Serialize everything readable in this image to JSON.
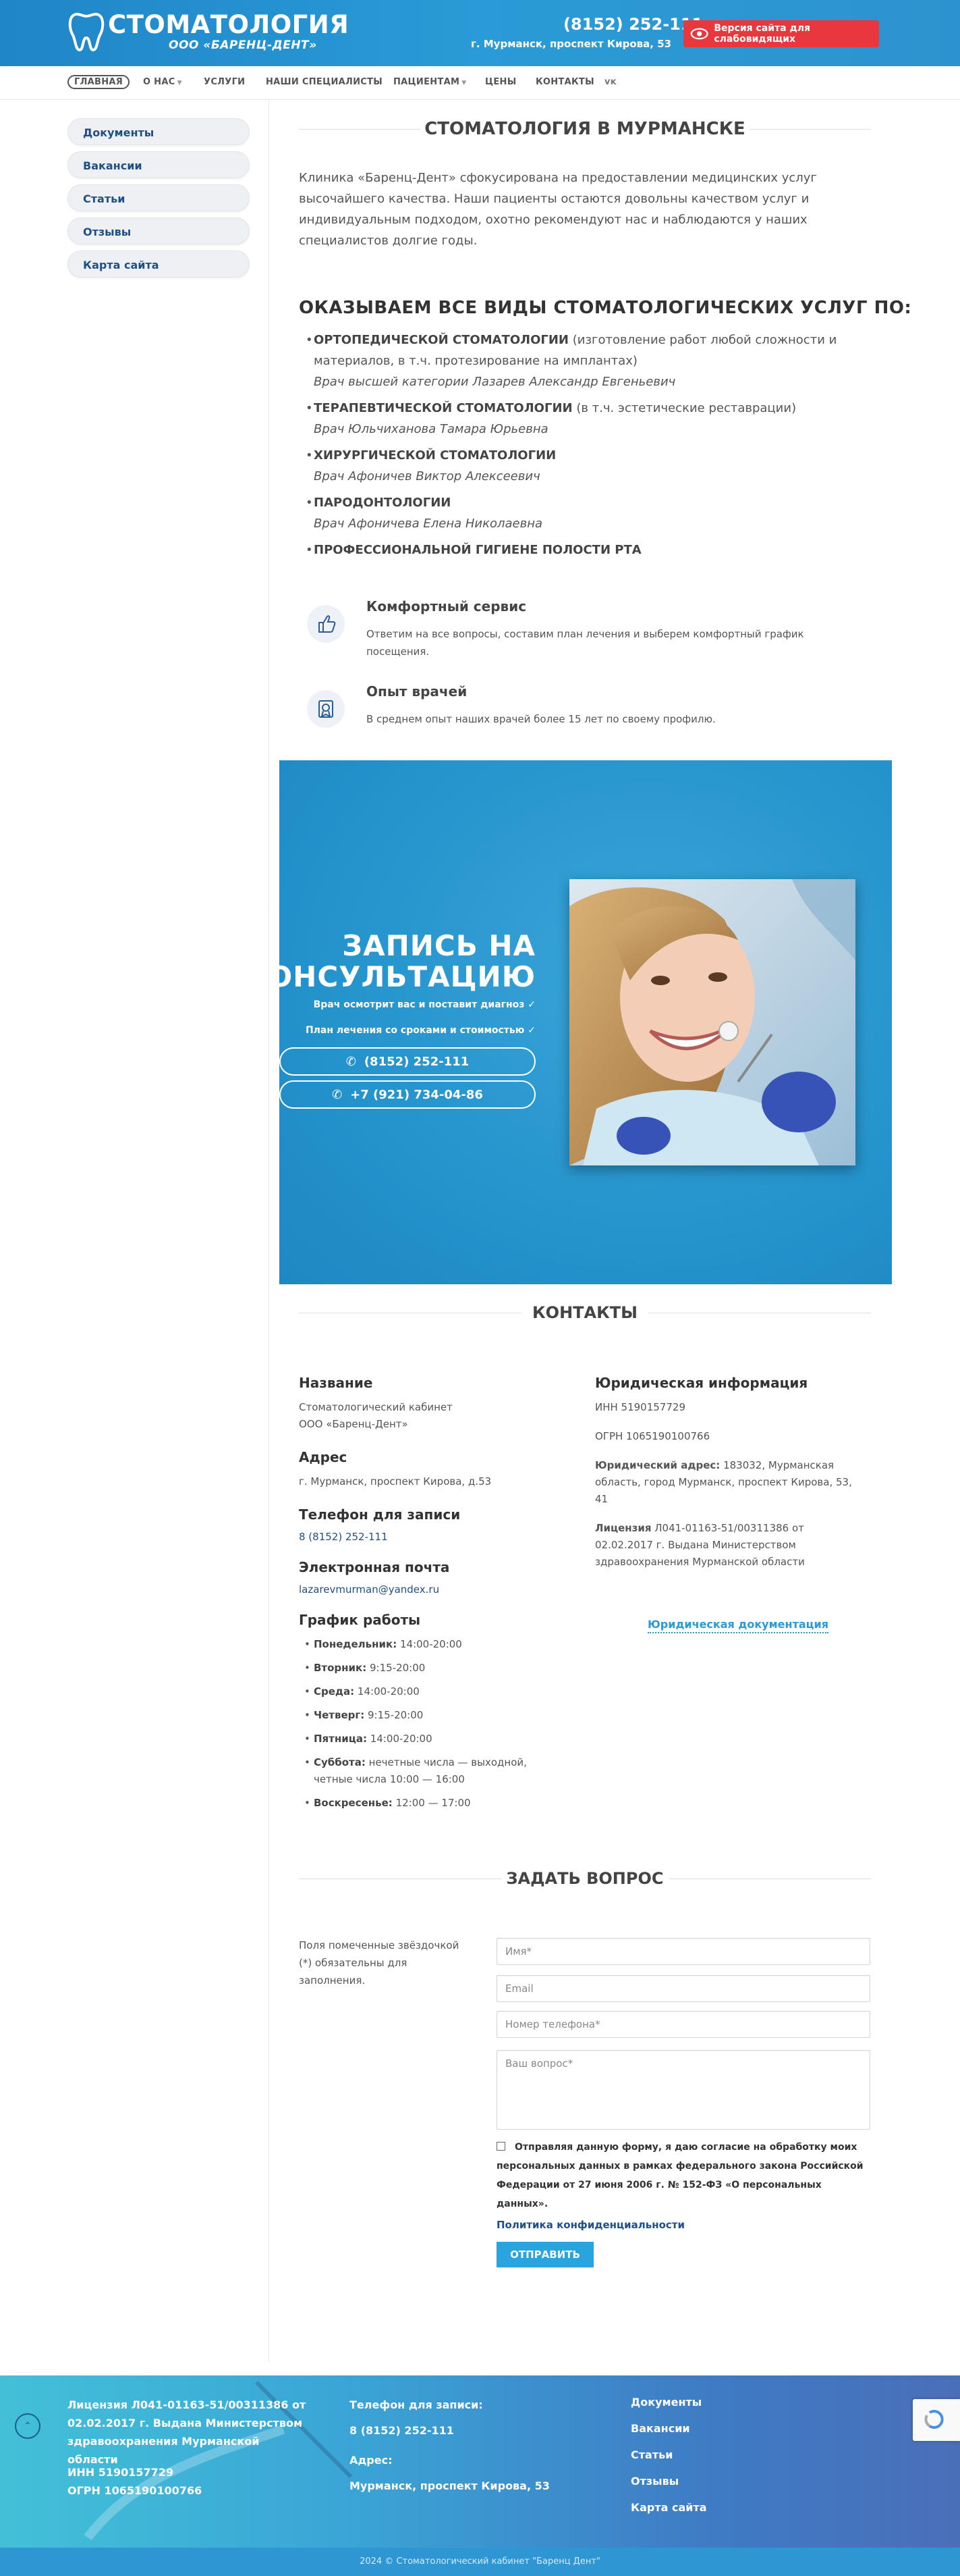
{
  "header": {
    "logo_title": "СТОМАТОЛОГИЯ",
    "logo_sub": "ООО «БАРЕНЦ-ДЕНТ»",
    "phone": "(8152) 252-111",
    "address": "г. Мурманск, проспект Кирова, 53",
    "vision_button": "Версия сайта для слабовидящих"
  },
  "nav": {
    "items": [
      "ГЛАВНАЯ",
      "О НАС",
      "УСЛУГИ",
      "НАШИ СПЕЦИАЛИСТЫ",
      "ПАЦИЕНТАМ",
      "ЦЕНЫ",
      "КОНТАКТЫ"
    ]
  },
  "sidebar": {
    "items": [
      "Документы",
      "Вакансии",
      "Статьи",
      "Отзывы",
      "Карта сайта"
    ]
  },
  "main": {
    "title": "СТОМАТОЛОГИЯ В МУРМАНСКЕ",
    "intro": "Клиника «Баренц-Дент» сфокусирована на предоставлении медицинских услуг высочайшего качества. Наши пациенты остаются довольны качеством услуг и индивидуальным подходом, охотно рекомендуют нас и наблюдаются у наших специалистов долгие годы.",
    "services_title": "ОКАЗЫВАЕМ ВСЕ ВИДЫ СТОМАТОЛОГИЧЕСКИХ УСЛУГ ПО:",
    "services": [
      {
        "name": "ОРТОПЕДИЧЕСКОЙ СТОМАТОЛОГИИ",
        "extra": " (изготовление работ любой сложности и материалов, в т.ч. протезирование на имплантах)",
        "doctor": "Врач высшей категории Лазарев Александр Евгеньевич"
      },
      {
        "name": "ТЕРАПЕВТИЧЕСКОЙ СТОМАТОЛОГИИ",
        "extra": " (в т.ч. эстетические реставрации)",
        "doctor": "Врач Юльчиханова Тамара Юрьевна"
      },
      {
        "name": "ХИРУРГИЧЕСКОЙ СТОМАТОЛОГИИ",
        "extra": "",
        "doctor": "Врач Афоничев Виктор Алексеевич"
      },
      {
        "name": "ПАРОДОНТОЛОГИИ",
        "extra": "",
        "doctor": "Врач Афоничева Елена Николаевна"
      },
      {
        "name": "ПРОФЕССИОНАЛЬНОЙ ГИГИЕНЕ ПОЛОСТИ РТА",
        "extra": "",
        "doctor": ""
      }
    ],
    "features": [
      {
        "title": "Комфортный сервис",
        "text": "Ответим на все вопросы, составим план лечения и выберем комфортный график посещения."
      },
      {
        "title": "Опыт врачей",
        "text": "В среднем опыт наших врачей более 15 лет по своему профилю."
      }
    ]
  },
  "banner": {
    "title_line1": "ЗАПИСЬ НА",
    "title_line2": "КОНСУЛЬТАЦИЮ",
    "note1": "Врач осмотрит вас и поставит диагноз ✓",
    "note2": "План лечения со сроками и стоимостью ✓",
    "phone1": "(8152) 252-111",
    "phone2": "+7 (921) 734-04-86"
  },
  "contacts": {
    "title": "КОНТАКТЫ",
    "name_h": "Название",
    "name_v": "Стоматологический кабинет ООО «Баренц-Дент»",
    "addr_h": "Адрес",
    "addr_v": "г. Мурманск, проспект Кирова, д.53",
    "phone_h": "Телефон для записи",
    "phone_v": "8 (8152) 252-111",
    "email_h": "Электронная почта",
    "email_v": "lazarevmurman@yandex.ru",
    "hours_h": "График работы",
    "hours": [
      {
        "day": "Понедельник:",
        "time": " 14:00-20:00"
      },
      {
        "day": "Вторник:",
        "time": " 9:15-20:00"
      },
      {
        "day": "Среда:",
        "time": " 14:00-20:00"
      },
      {
        "day": "Четверг:",
        "time": " 9:15-20:00"
      },
      {
        "day": "Пятница:",
        "time": " 14:00-20:00"
      },
      {
        "day": "Суббота:",
        "time": " нечетные числа — выходной, четные числа 10:00 — 16:00"
      },
      {
        "day": "Воскресенье:",
        "time": " 12:00 — 17:00"
      }
    ],
    "jur_h": "Юридическая информация",
    "inn": "ИНН 5190157729",
    "ogrn": "ОГРН 1065190100766",
    "jur_addr_label": "Юридический адрес:",
    "jur_addr": " 183032, Мурманская область, город Мурманск, проспект Кирова, 53, 41",
    "license_label": "Лицензия",
    "license": " Л041-01163-51/00311386 от 02.02.2017 г. Выдана Министерством здравоохранения Мурманской области",
    "jur_docs": "Юридическая документация"
  },
  "form": {
    "title": "ЗАДАТЬ ВОПРОС",
    "note": "Поля помеченные звёздочкой (*) обязательны для заполнения.",
    "name_ph": "Имя*",
    "email_ph": "Email",
    "phone_ph": "Номер телефона*",
    "question_ph": "Ваш вопрос*",
    "agree": "Отправляя данную форму, я даю согласие на обработку моих персональных данных в рамках федерального закона Российской Федерации от 27 июня 2006 г. № 152-ФЗ «О персональных данных».",
    "policy": "Политика конфиденциальности",
    "submit": "ОТПРАВИТЬ"
  },
  "footer": {
    "license": "Лицензия Л041-01163-51/00311386 от 02.02.2017 г. Выдана Министерством здравоохранения Мурманской области",
    "inn": "ИНН 5190157729",
    "ogrn": "ОГРН 1065190100766",
    "phone_h": "Телефон для записи:",
    "phone": "8 (8152) 252-111",
    "addr_h": "Адрес:",
    "addr": "Мурманск, проспект Кирова, 53",
    "links": [
      "Документы",
      "Вакансии",
      "Статьи",
      "Отзывы",
      "Карта сайта"
    ],
    "copyright": "2024 © Стоматологический кабинет \"Баренц Дент\""
  },
  "colors": {
    "brand_blue": "#2a9bd6",
    "alert_red": "#e8373d",
    "link_blue": "#1f4f87"
  }
}
